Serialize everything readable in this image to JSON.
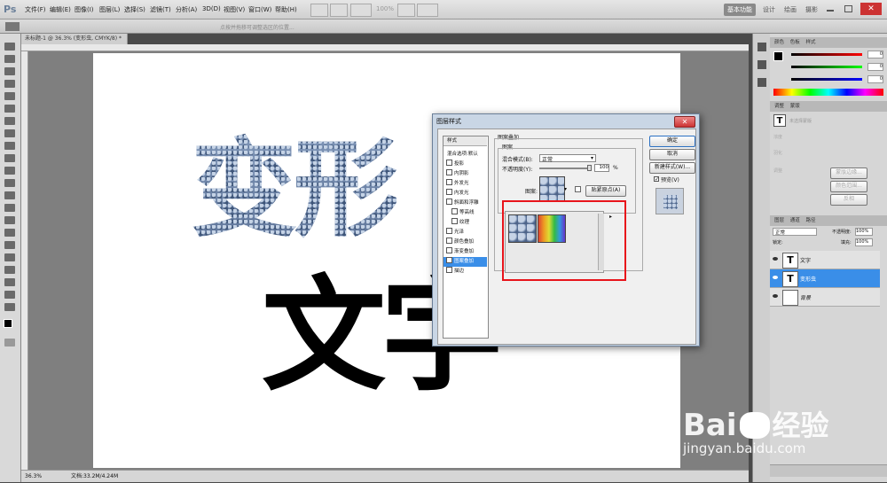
{
  "app": {
    "logo": "Ps"
  },
  "menu": [
    "文件(F)",
    "编辑(E)",
    "图像(I)",
    "图层(L)",
    "选择(S)",
    "滤镜(T)",
    "分析(A)",
    "3D(D)",
    "视图(V)",
    "窗口(W)",
    "帮助(H)"
  ],
  "menubar": {
    "zoom": "100%",
    "workspaces": [
      "基本功能",
      "设计",
      "绘画",
      "摄影"
    ]
  },
  "options_bar": {
    "hint": "点按并拖移可调整选区的位置..."
  },
  "document": {
    "tab": "未标题-1 @ 36.3% (变形虫, CMYK/8) *",
    "pattern_text": "变形",
    "black_text": "文字"
  },
  "status": {
    "zoom": "36.3%",
    "doc_size": "文档:33.2M/4.24M"
  },
  "panels": {
    "color_tabs": [
      "颜色",
      "色板",
      "样式"
    ],
    "color_values": [
      "0",
      "0",
      "0"
    ],
    "char_tabs": [
      "调整",
      "蒙版"
    ],
    "char_placeholder": "未选择蒙版",
    "char_labels": [
      "浓度",
      "羽化",
      "调整"
    ],
    "char_buttons": [
      "蒙版边缘...",
      "颜色范围...",
      "反相"
    ],
    "layers_tabs": [
      "图层",
      "通道",
      "路径"
    ],
    "blend_mode": "正常",
    "opacity_label": "不透明度:",
    "opacity": "100%",
    "lock_label": "锁定:",
    "fill_label": "填充:",
    "fill": "100%",
    "layers": [
      {
        "name": "文字",
        "thumb": "T"
      },
      {
        "name": "变形虫",
        "thumb": "T"
      },
      {
        "name": "背景",
        "thumb": ""
      }
    ]
  },
  "dialog": {
    "title": "图层样式",
    "styles": [
      {
        "label": "样式",
        "type": "header"
      },
      {
        "label": "混合选项:默认",
        "type": "plain"
      },
      {
        "label": "投影",
        "type": "cb"
      },
      {
        "label": "内阴影",
        "type": "cb"
      },
      {
        "label": "外发光",
        "type": "cb"
      },
      {
        "label": "内发光",
        "type": "cb"
      },
      {
        "label": "斜面和浮雕",
        "type": "cb"
      },
      {
        "label": "等高线",
        "type": "sub"
      },
      {
        "label": "纹理",
        "type": "sub"
      },
      {
        "label": "光泽",
        "type": "cb"
      },
      {
        "label": "颜色叠加",
        "type": "cb"
      },
      {
        "label": "渐变叠加",
        "type": "cb"
      },
      {
        "label": "图案叠加",
        "type": "sel"
      },
      {
        "label": "描边",
        "type": "cb"
      }
    ],
    "section_title": "图案叠加",
    "group_title": "图案",
    "blend_label": "混合模式(B):",
    "blend_value": "正常",
    "opacity_label": "不透明度(Y):",
    "opacity_value": "100",
    "opacity_unit": "%",
    "pattern_label": "图案:",
    "snap_button": "贴紧原点(A)",
    "buttons": {
      "ok": "确定",
      "cancel": "取消",
      "new_style": "新建样式(W)...",
      "preview": "预览(V)"
    }
  },
  "watermark": {
    "brand": "Bai",
    "brand2": "经验",
    "url": "jingyan.baidu.com"
  }
}
